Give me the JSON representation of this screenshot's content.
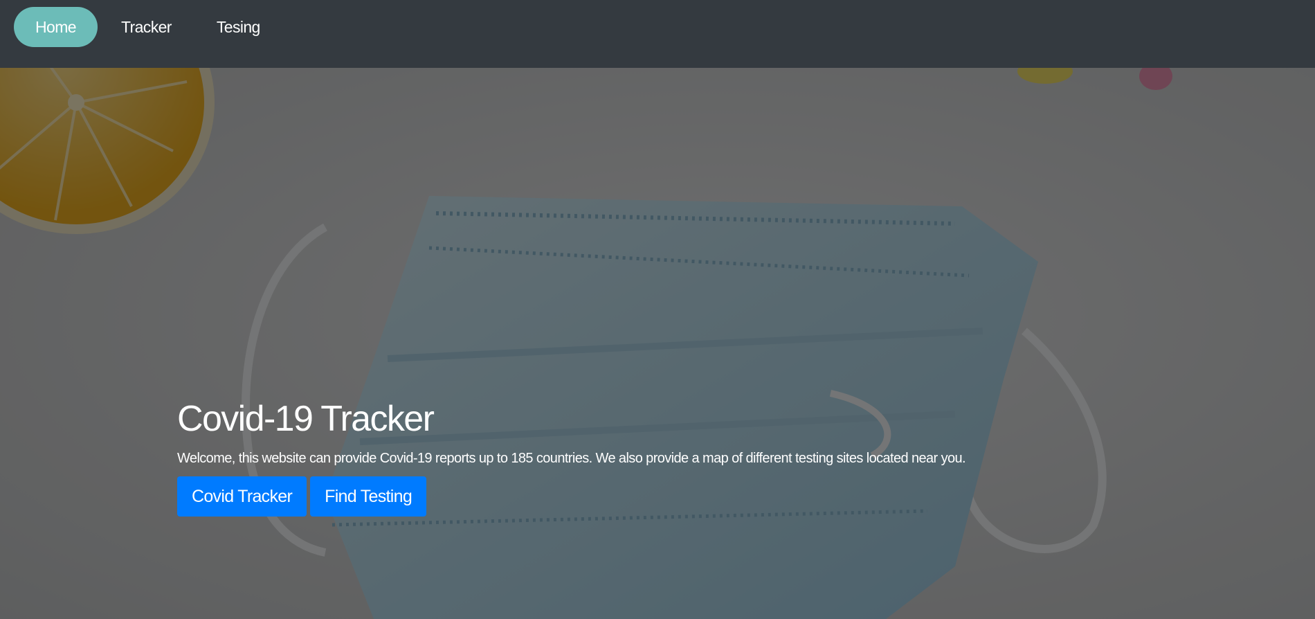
{
  "nav": {
    "items": [
      {
        "label": "Home",
        "active": true
      },
      {
        "label": "Tracker",
        "active": false
      },
      {
        "label": "Tesing",
        "active": false
      }
    ],
    "background_color": "#343a40",
    "active_color": "#6cbcb8"
  },
  "hero": {
    "background_image": "face-mask-photo",
    "title": "Covid-19 Tracker",
    "description": "Welcome, this website can provide Covid-19 reports up to 185 countries. We also provide a map of different testing sites located near you.",
    "buttons": {
      "tracker_label": "Covid Tracker",
      "testing_label": "Find Testing"
    },
    "button_color": "#007bff"
  }
}
